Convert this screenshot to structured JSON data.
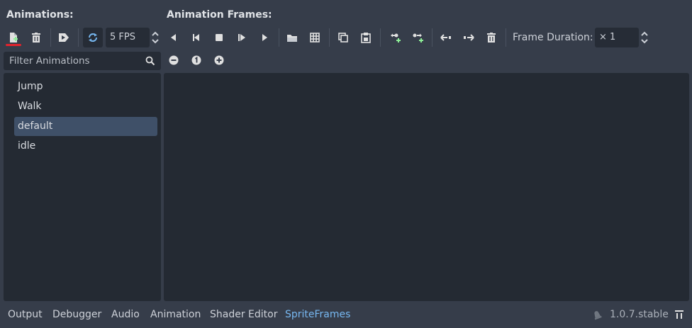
{
  "animations_panel": {
    "header": "Animations:",
    "fps_value": "5 FPS",
    "filter_placeholder": "Filter Animations",
    "items": [
      {
        "label": "Jump",
        "selected": false
      },
      {
        "label": "Walk",
        "selected": false
      },
      {
        "label": "default",
        "selected": true
      },
      {
        "label": "idle",
        "selected": false
      }
    ]
  },
  "frames_panel": {
    "header": "Animation Frames:",
    "frame_duration_label": "Frame Duration:",
    "frame_duration_value": "× 1"
  },
  "bottom_bar": {
    "tabs": [
      "Output",
      "Debugger",
      "Audio",
      "Animation",
      "Shader Editor",
      "SpriteFrames"
    ],
    "active_tab": "SpriteFrames",
    "version": "1.0.7.stable"
  },
  "colors": {
    "accent": "#77b8f1",
    "add_green": "#8eef97",
    "underline_red": "#e3232d",
    "selection": "#3f5068"
  }
}
